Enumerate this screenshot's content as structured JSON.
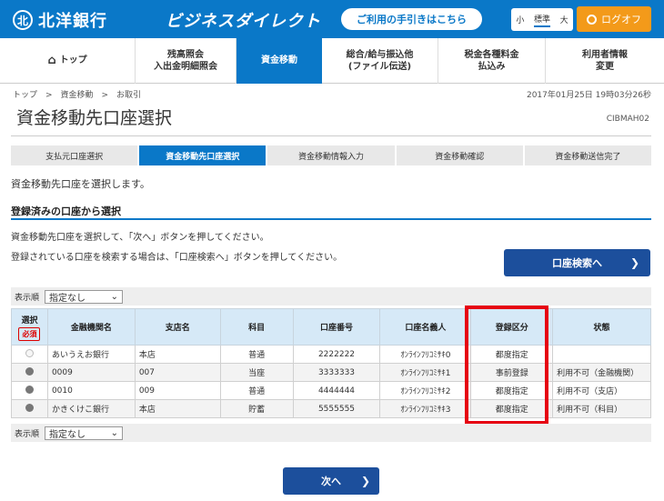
{
  "header": {
    "logo_mark": "北",
    "logo_text": "北洋銀行",
    "service_name": "ビジネスダイレクト",
    "guide_label": "ご利用の手引きはこちら",
    "font_sizes": [
      "小",
      "標準",
      "大"
    ],
    "logout_label": "ログオフ",
    "brand_color": "#0a78c8",
    "logout_color": "#f39a1a"
  },
  "nav": {
    "items": [
      {
        "label": "トップ",
        "icon": "home-icon"
      },
      {
        "label": "残高照会\n入出金明細照会"
      },
      {
        "label": "資金移動",
        "active": true
      },
      {
        "label": "総合/給与振込他\n(ファイル伝送)"
      },
      {
        "label": "税金各種料金\n払込み"
      },
      {
        "label": "利用者情報\n変更"
      }
    ]
  },
  "breadcrumb": "トップ　>　資金移動　>　お取引",
  "timestamp": "2017年01月25日 19時03分26秒",
  "page_title": "資金移動先口座選択",
  "screen_id": "CIBMAH02",
  "steps": [
    "支払元口座選択",
    "資金移動先口座選択",
    "資金移動情報入力",
    "資金移動確認",
    "資金移動送信完了"
  ],
  "active_step": 1,
  "intro": "資金移動先口座を選択します。",
  "section_title": "登録済みの口座から選択",
  "desc1": "資金移動先口座を選択して、「次へ」ボタンを押してください。",
  "desc2": "登録されている口座を検索する場合は、「口座検索へ」ボタンを押してください。",
  "search_button": "口座検索へ",
  "sort": {
    "label": "表示順",
    "value": "指定なし"
  },
  "table": {
    "headers": {
      "select": "選択",
      "required": "必須",
      "bank": "金融機関名",
      "branch": "支店名",
      "subject": "科目",
      "account": "口座番号",
      "holder": "口座名義人",
      "reg_type": "登録区分",
      "status": "状態"
    },
    "rows": [
      {
        "bank": "あいうえお銀行",
        "branch": "本店",
        "subject": "普通",
        "account": "2222222",
        "holder": "ｵﾝﾗｲﾝﾌﾘｺﾐｻｷ0",
        "reg_type": "都度指定",
        "status": "",
        "radio": "dis"
      },
      {
        "bank": "0009",
        "branch": "007",
        "subject": "当座",
        "account": "3333333",
        "holder": "ｵﾝﾗｲﾝﾌﾘｺﾐｻｷ1",
        "reg_type": "事前登録",
        "status": "利用不可（金融機関）",
        "radio": "off"
      },
      {
        "bank": "0010",
        "branch": "009",
        "subject": "普通",
        "account": "4444444",
        "holder": "ｵﾝﾗｲﾝﾌﾘｺﾐｻｷ2",
        "reg_type": "都度指定",
        "status": "利用不可（支店）",
        "radio": "off"
      },
      {
        "bank": "かきくけこ銀行",
        "branch": "本店",
        "subject": "貯蓄",
        "account": "5555555",
        "holder": "ｵﾝﾗｲﾝﾌﾘｺﾐｻｷ3",
        "reg_type": "都度指定",
        "status": "利用不可（科目）",
        "radio": "off"
      }
    ]
  },
  "next_button": "次へ"
}
